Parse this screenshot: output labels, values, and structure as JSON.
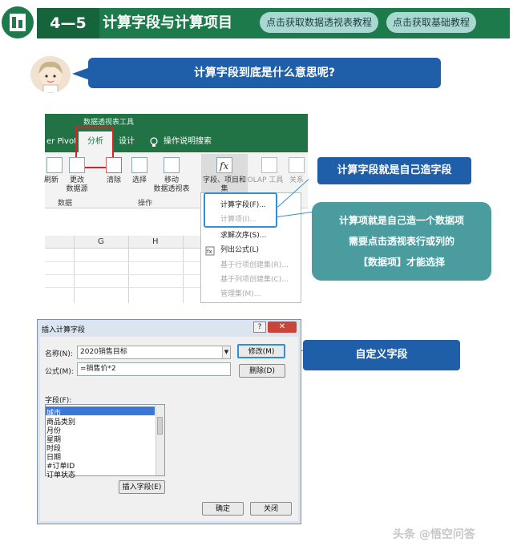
{
  "header": {
    "number": "4—5",
    "title": "计算字段与计算项目",
    "links": [
      "点击获取数据透视表教程",
      "点击获取基础教程"
    ]
  },
  "question": "计算字段到底是什么意思呢?",
  "ribbon": {
    "context_tool": "数据透视表工具",
    "tabs": [
      "er Pivot",
      "分析",
      "设计",
      "操作说明搜索"
    ],
    "buttons": {
      "refresh": "刷新",
      "change_source": "更改\n数据源",
      "clear": "清除",
      "select": "选择",
      "move": "移动\n数据透视表",
      "fields_items": "字段、项目和\n集",
      "olap": "OLAP 工具",
      "relations": "关系"
    },
    "groups": [
      "数据",
      "操作"
    ],
    "columns": [
      "G",
      "H"
    ]
  },
  "menu": {
    "items": [
      {
        "label": "计算字段(F)...",
        "disabled": false
      },
      {
        "label": "计算项(I)...",
        "disabled": true
      },
      {
        "label": "求解次序(S)...",
        "disabled": false
      },
      {
        "label": "列出公式(L)",
        "disabled": false
      },
      {
        "label": "基于行项创建集(R)...",
        "disabled": true
      },
      {
        "label": "基于列项创建集(C)...",
        "disabled": true
      },
      {
        "label": "管理集(M)...",
        "disabled": true
      }
    ]
  },
  "callouts": {
    "c1": "计算字段就是自己造字段",
    "c2_line1": "计算项就是自己造一个数据项",
    "c2_line2": "需要点击透视表行或列的",
    "c2_line3": "【数据项】才能选择",
    "c3": "自定义字段"
  },
  "dialog": {
    "title": "插入计算字段",
    "help": "?",
    "close": "✕",
    "name_label": "名称(N):",
    "name_value": "2020销售目标",
    "formula_label": "公式(M):",
    "formula_value": "=销售价*2",
    "modify_button": "修改(M)",
    "delete_button": "删除(D)",
    "fields_label": "字段(F):",
    "fields": [
      "城市",
      "商品类别",
      "月份",
      "星期",
      "时段",
      "日期",
      "#订单ID",
      "订单状态"
    ],
    "insert_field_button": "插入字段(E)",
    "ok_button": "确定",
    "close_button": "关闭"
  },
  "watermark": "头条 @悟空问答",
  "colors": {
    "header_green": "#1d7a4a",
    "callout_blue": "#1f5ea8",
    "callout_teal": "#4a9c9f",
    "highlight_red": "#e02020",
    "highlight_blue": "#2f8fd6"
  }
}
